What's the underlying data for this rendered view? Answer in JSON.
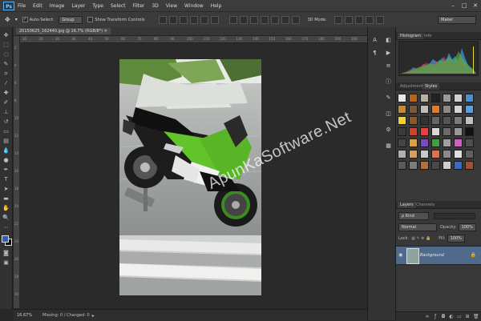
{
  "app": {
    "logo": "Ps",
    "logo_icon": "photoshop-logo-icon"
  },
  "menu": [
    "File",
    "Edit",
    "Image",
    "Layer",
    "Type",
    "Select",
    "Filter",
    "3D",
    "View",
    "Window",
    "Help"
  ],
  "options_bar": {
    "auto_select_label": "Auto-Select:",
    "auto_select_value": "Group",
    "show_transform_label": "Show Transform Controls",
    "mode_3d_label": "3D Mode:",
    "workspace_value": "Maker"
  },
  "document": {
    "tab_label": "20150625_162440.jpg @ 16.7% (RGB/8*)",
    "zoom": "16.67%",
    "status": "Missing: 0 / Changed: 0"
  },
  "ruler_h_ticks": [
    "16",
    "20",
    "20",
    "30",
    "40",
    "50",
    "60",
    "70",
    "80",
    "90",
    "100",
    "110",
    "120",
    "130",
    "140",
    "150",
    "160",
    "170",
    "180",
    "190",
    "200"
  ],
  "ruler_v_ticks": [
    "2",
    "4",
    "6",
    "8",
    "10",
    "12",
    "14",
    "16",
    "18",
    "20",
    "22",
    "24",
    "26",
    "28",
    "30"
  ],
  "watermark": "ApunKaSoftware.Net",
  "panels": {
    "histogram_tabs": [
      "Histogram",
      "Info"
    ],
    "adjustment_tabs": [
      "Adjustments",
      "Styles"
    ],
    "layers_tabs": [
      "Layers",
      "Channels"
    ],
    "kind_value": "Kind",
    "blend_mode": "Normal",
    "opacity_label": "Opacity:",
    "opacity_value": "100%",
    "lock_label": "Lock:",
    "fill_label": "Fill:",
    "fill_value": "100%",
    "layer_name": "Background"
  },
  "colors": {
    "foreground": "#2b5fb8",
    "background": "#111111",
    "selected_layer": "#4f6a8a"
  }
}
